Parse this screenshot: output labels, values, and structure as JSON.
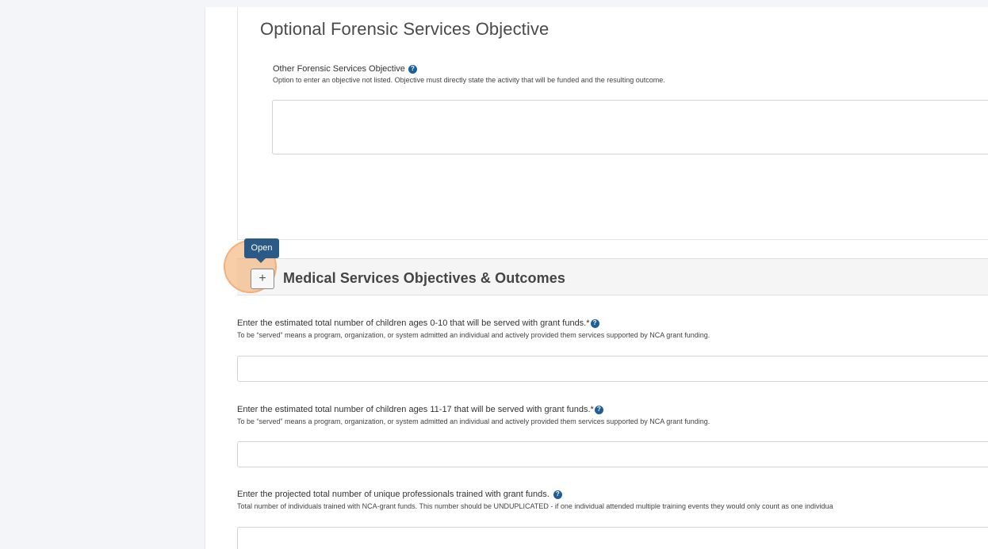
{
  "forensic_section": {
    "title": "Optional Forensic Services Objective",
    "other_objective_label": "Other Forensic Services Objective",
    "other_objective_help": "Option to enter an objective not listed. Objective must directly state the activity that will be funded and the resulting outcome.",
    "other_objective_value": ""
  },
  "tooltip": {
    "text": "Open"
  },
  "medical_section": {
    "title": "Medical Services Objectives & Outcomes",
    "toggle_symbol": "+"
  },
  "questions": [
    {
      "label": "Enter the estimated total number of children ages 0-10 that will be served with grant funds.*",
      "help": "To be “served” means a program, organization, or system admitted an individual and actively provided them services supported by NCA grant funding.",
      "value": ""
    },
    {
      "label": "Enter the estimated total number of children ages 11-17 that will be served with grant funds.*",
      "help": "To be “served” means a program, organization, or system admitted an individual and actively provided them services supported by NCA grant funding.",
      "value": ""
    },
    {
      "label": "Enter the projected total number of unique professionals trained with grant funds.",
      "help": "Total number of individuals trained with NCA-grant funds. This number should be UNDUPLICATED - if one individual attended multiple training events they would only count as one individua",
      "value": ""
    }
  ],
  "help_icon_glyph": "?",
  "colors": {
    "help_icon": "#1e5f99",
    "tooltip": "#2b5a87",
    "highlight": "#f3a560"
  }
}
